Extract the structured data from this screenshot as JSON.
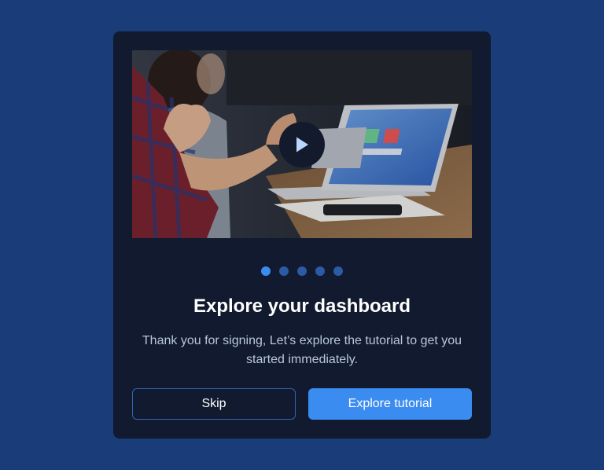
{
  "colors": {
    "page_background": "#1a3c78",
    "card_background": "#111a2e",
    "accent": "#3b8cf0",
    "dot_inactive": "#2d5aa5",
    "skip_border": "#3363b4"
  },
  "media": {
    "image_subject": "office meeting with laptop",
    "play_icon": "play-icon"
  },
  "carousel": {
    "total_slides": 5,
    "active_slide": 1
  },
  "onboarding": {
    "title": "Explore your dashboard",
    "description": "Thank you for signing, Let’s explore the tutorial to get you started immediately."
  },
  "actions": {
    "skip_label": "Skip",
    "explore_label": "Explore tutorial"
  }
}
